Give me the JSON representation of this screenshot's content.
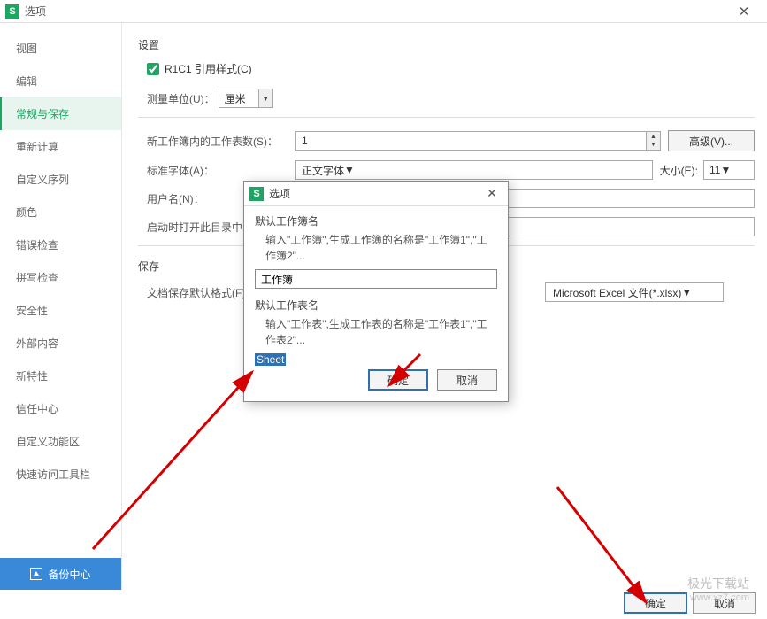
{
  "titlebar": {
    "title": "选项",
    "icon_letter": "S"
  },
  "sidebar": {
    "items": [
      {
        "label": "视图"
      },
      {
        "label": "编辑"
      },
      {
        "label": "常规与保存"
      },
      {
        "label": "重新计算"
      },
      {
        "label": "自定义序列"
      },
      {
        "label": "颜色"
      },
      {
        "label": "错误检查"
      },
      {
        "label": "拼写检查"
      },
      {
        "label": "安全性"
      },
      {
        "label": "外部内容"
      },
      {
        "label": "新特性"
      },
      {
        "label": "信任中心"
      },
      {
        "label": "自定义功能区"
      },
      {
        "label": "快速访问工具栏"
      }
    ],
    "footer": "备份中心"
  },
  "settings": {
    "section_title": "设置",
    "r1c1_label": "R1C1 引用样式(C)",
    "measure_label": "测量单位(U)：",
    "measure_value": "厘米",
    "sheets_label": "新工作簿内的工作表数(S)：",
    "sheets_value": "1",
    "advanced_btn": "高级(V)...",
    "font_label": "标准字体(A)：",
    "font_value": "正文字体",
    "size_label": "大小(E):",
    "size_value": "11",
    "username_label": "用户名(N)：",
    "startup_label": "启动时打开此目录中",
    "save_section": "保存",
    "saveformat_label": "文档保存默认格式(F)",
    "saveformat_value": "Microsoft Excel 文件(*.xlsx)"
  },
  "inner_dialog": {
    "title": "选项",
    "icon_letter": "S",
    "group1_label": "默认工作簿名",
    "group1_help": "输入\"工作簿\",生成工作簿的名称是\"工作簿1\",\"工作簿2\"...",
    "group1_value": "工作簿",
    "group2_label": "默认工作表名",
    "group2_help": "输入\"工作表\",生成工作表的名称是\"工作表1\",\"工作表2\"...",
    "group2_value": "Sheet",
    "ok": "确定",
    "cancel": "取消"
  },
  "bottom": {
    "ok": "确定",
    "cancel": "取消"
  },
  "watermark": {
    "line1": "极光下载站",
    "line2": "www.xz7.com"
  }
}
